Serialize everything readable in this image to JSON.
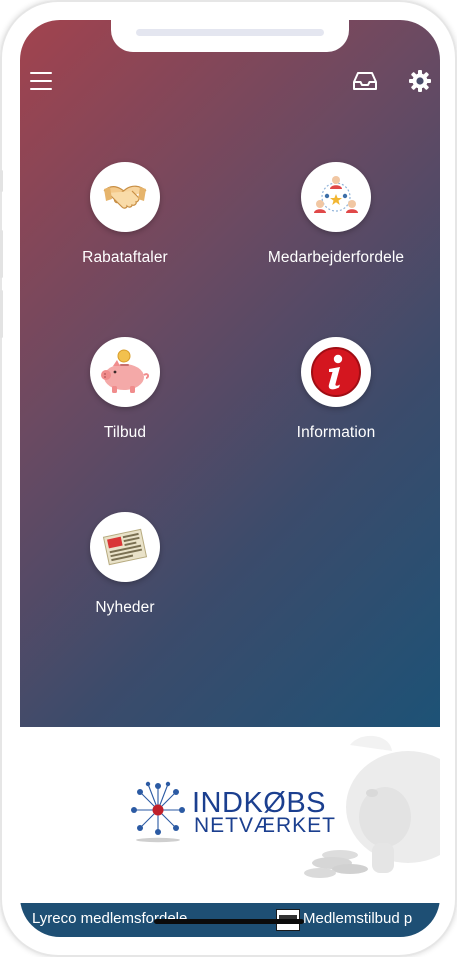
{
  "header": {
    "menu_icon": "hamburger-menu-icon",
    "inbox_icon": "inbox-icon",
    "settings_icon": "gear-icon"
  },
  "tiles": [
    {
      "label": "Rabataftaler",
      "icon": "handshake-icon"
    },
    {
      "label": "Medarbejderfordele",
      "icon": "employee-network-icon"
    },
    {
      "label": "Tilbud",
      "icon": "piggy-bank-icon"
    },
    {
      "label": "Information",
      "icon": "info-icon"
    },
    {
      "label": "Nyheder",
      "icon": "newspaper-icon"
    }
  ],
  "banner": {
    "logo_line1": "INDKØBS",
    "logo_line2": "NETVÆRKET",
    "logo_alt": "Indkøbsnetværket logo"
  },
  "ticker": {
    "items": [
      {
        "text": "Lyreco medlemsfordele"
      },
      {
        "text": "Medlemstilbud p"
      }
    ]
  },
  "colors": {
    "gradient_start": "#a2434e",
    "gradient_end": "#1d5276",
    "ticker_bg": "#1e4f74",
    "logo_blue": "#1b3f8f",
    "logo_accent": "#c0202a"
  }
}
